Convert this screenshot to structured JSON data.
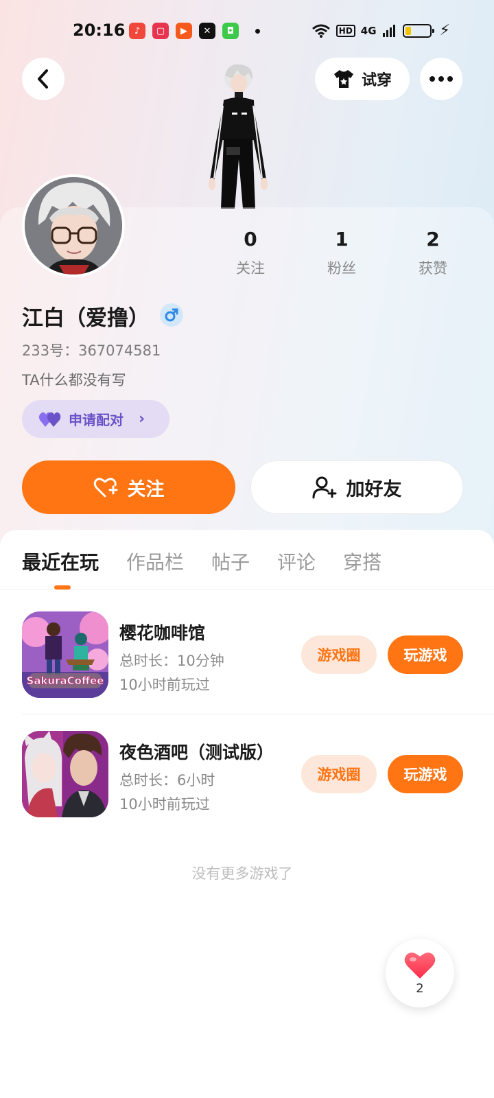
{
  "status_bar": {
    "time": "20:16",
    "network": "4G",
    "hd": "HD"
  },
  "header": {
    "tryon_label": "试穿"
  },
  "profile": {
    "name": "江白（爱撸）",
    "gender_symbol": "♂",
    "uid": "233号：367074581",
    "bio": "TA什么都没有写",
    "pair_label": "申请配对",
    "stats": [
      {
        "value": "0",
        "label": "关注"
      },
      {
        "value": "1",
        "label": "粉丝"
      },
      {
        "value": "2",
        "label": "获赞"
      }
    ]
  },
  "actions": {
    "follow_label": "关注",
    "add_friend_label": "加好友"
  },
  "tabs": [
    "最近在玩",
    "作品栏",
    "帖子",
    "评论",
    "穿搭"
  ],
  "games": [
    {
      "title": "樱花咖啡馆",
      "duration": "总时长：10分钟",
      "last_played": "10小时前玩过",
      "icon_text": "SakuraCoffee",
      "circle_label": "游戏圈",
      "play_label": "玩游戏"
    },
    {
      "title": "夜色酒吧（测试版）",
      "duration": "总时长：6小时",
      "last_played": "10小时前玩过",
      "circle_label": "游戏圈",
      "play_label": "玩游戏"
    }
  ],
  "footer": {
    "no_more": "没有更多游戏了"
  },
  "like_fab": {
    "count": "2"
  },
  "colors": {
    "accent": "#ff7413",
    "pair_purple": "#6b52c8"
  }
}
